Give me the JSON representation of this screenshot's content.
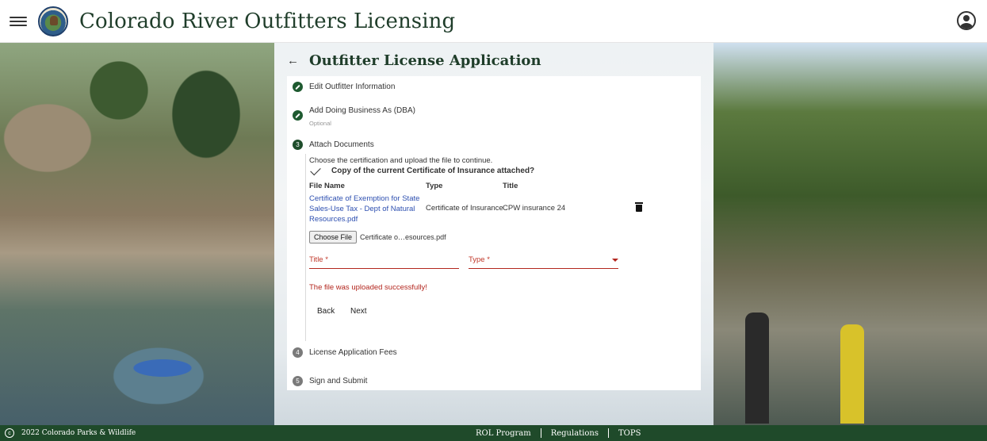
{
  "header": {
    "app_title": "Colorado River Outfitters Licensing"
  },
  "page": {
    "title": "Outfitter License Application"
  },
  "steps": [
    {
      "number": "",
      "label": "Edit Outfitter Information",
      "sub": "",
      "state": "done"
    },
    {
      "number": "",
      "label": "Add Doing Business As (DBA)",
      "sub": "Optional",
      "state": "done"
    },
    {
      "number": "3",
      "label": "Attach Documents",
      "sub": "",
      "state": "active"
    },
    {
      "number": "4",
      "label": "License Application Fees",
      "sub": "",
      "state": "todo"
    },
    {
      "number": "5",
      "label": "Sign and Submit",
      "sub": "",
      "state": "todo"
    }
  ],
  "attach": {
    "instruction": "Choose the certification and upload the file to continue.",
    "certificate_prompt": "Copy of the current Certificate of Insurance attached?",
    "columns": [
      "File Name",
      "Type",
      "Title"
    ],
    "files": [
      {
        "file_name": "Certificate of Exemption for State Sales-Use Tax - Dept of Natural Resources.pdf",
        "type": "Certificate of Insurance",
        "title": "CPW insurance 24"
      }
    ],
    "choose_file_label": "Choose File",
    "chosen_file": "Certificate o…esources.pdf",
    "title_placeholder": "Title *",
    "type_placeholder": "Type *",
    "success_message": "The file was uploaded successfully!",
    "back_label": "Back",
    "next_label": "Next"
  },
  "footer": {
    "copyright_symbol": "c",
    "copyright": "2022 Colorado Parks & Wildlife",
    "links": [
      "ROL Program",
      "Regulations",
      "TOPS"
    ]
  }
}
